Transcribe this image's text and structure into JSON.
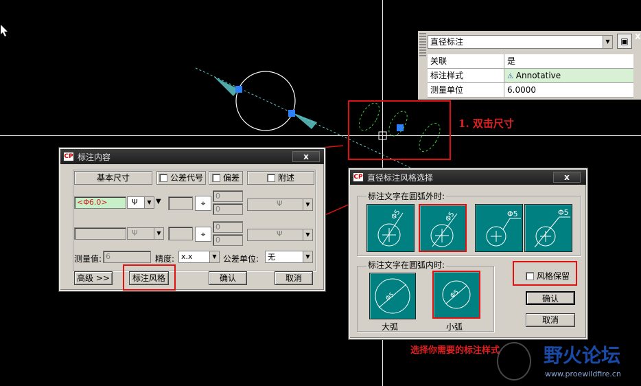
{
  "prop_panel": {
    "dropdown_value": "直径标注",
    "rows": [
      {
        "key": "关联",
        "value": "是"
      },
      {
        "key": "标注样式",
        "value": "Annotative"
      },
      {
        "key": "测量单位",
        "value": "6.0000"
      }
    ]
  },
  "annotation": {
    "step1": "1. 双击尺寸",
    "step2": "选择你需要的标注样式"
  },
  "dialog_content": {
    "title": "标注内容",
    "close": "x",
    "tab_basic": "基本尺寸",
    "tab_tolerance_code": "公差代号",
    "tab_deviation": "偏差",
    "tab_append": "附述",
    "dim_value": "<Φ6.0>",
    "symbol": "Ψ",
    "upper_dev": "0",
    "lower_dev": "0",
    "upper_dev2": "0",
    "lower_dev2": "0",
    "measured_label": "测量值:",
    "measured_value": "6",
    "precision_label": "精度:",
    "precision_value": "x.x",
    "tol_unit_label": "公差单位:",
    "tol_unit_value": "无",
    "btn_advanced": "高级 >>",
    "btn_style": "标注风格",
    "btn_ok": "确认",
    "btn_cancel": "取消"
  },
  "dialog_style": {
    "title": "直径标注风格选择",
    "close": "x",
    "outside_label": "标注文字在圆弧外时:",
    "inside_label": "标注文字在圆弧内时:",
    "outside_texts": [
      "Φ5",
      "Φ5",
      "Φ5",
      "Φ5"
    ],
    "inside_texts": [
      "Φ5",
      "Φ5"
    ],
    "big_arc": "大弧",
    "small_arc": "小弧",
    "keep_style": "风格保留",
    "btn_ok": "确认",
    "btn_cancel": "取消"
  },
  "watermark": {
    "title": "野火论坛",
    "url": "www.proewildfire.cn"
  },
  "colors": {
    "teal": "#008080",
    "red": "#e01010",
    "green_highlight": "#d0f0d0"
  }
}
